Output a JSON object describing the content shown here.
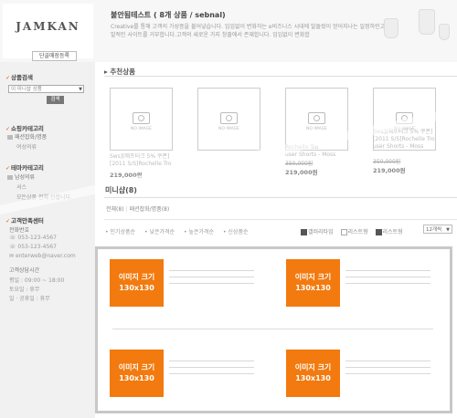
{
  "header": {
    "logo": "JAMKAN",
    "signup_label": "단골매장등록",
    "shop_title": "불안됨테스트 ( 8개 상품 / sebnal)",
    "desc_line1": "Creative를 통해 고객의 가성증을 불어넣습니다. 임임없이 변화하는 e비즈니스 시대에 발돌랐이 얻어지나는 일정하인고 윔",
    "desc_line2": "발적인 사이트를 거부합니다.고객의 새로운 가지 창출에서 존재합니다. 임임없이 변화합"
  },
  "sidebar": {
    "search": {
      "heading": "상품검색",
      "select_value": "이 미니샵 상품",
      "button": "검색"
    },
    "shop_category": {
      "heading": "쇼핑카테고리",
      "item": "패션잡화/명품",
      "sub": "여성의류"
    },
    "theme_category": {
      "heading": "테마카테고리",
      "item": "남성의류",
      "sub1": "셔스",
      "sub2": "모든상품 전체 진합니다."
    },
    "customer": {
      "heading": "고객만족센터",
      "phone_label": "전화번호",
      "phone1": "053-123-4567",
      "phone2": "053-123-4567",
      "email": "enterweb@naver.com",
      "hours_label": "고객상담시간",
      "weekday": "평일 : 09:00 ~ 18:00",
      "saturday": "토요일 : 휴무",
      "sunday": "일 · 공휴일 : 휴무"
    }
  },
  "recommended": {
    "heading": "추천상품",
    "no_image": "NO IMAGE",
    "items": [
      {
        "name1": "Sws](애프터크 5% 쿠폰]",
        "name2": "[2011 S/S]Rochelle Tro",
        "old": "",
        "price": "219,000원"
      },
      {
        "name1": "",
        "name2": "",
        "old": "",
        "price": ""
      },
      {
        "name1": "",
        "name2": "Rochelle Tro",
        "name3": "user Shorts - Moss",
        "old": "350,000원",
        "price": "219,000원"
      },
      {
        "name1": "Sws](애프터크 5% 쿠폰]",
        "name2": "[2011 S/S]Rochelle Tro",
        "name3": "user Shorts - Moss",
        "old": "350,000원",
        "price": "219,000원"
      }
    ]
  },
  "minishop": {
    "title": "미니샵(8)",
    "breadcrumb_all": "전체(8)",
    "breadcrumb_cat": "패션잡화/명품(8)",
    "sort": [
      "인기상품순",
      "낮은가격순",
      "높은가격순",
      "신상품순"
    ],
    "view_options": [
      "갤러리타입",
      "리스트형",
      "리스트형"
    ],
    "perpage": "12개씩",
    "thumb_line1": "이미지 크기",
    "thumb_line2": "130x130"
  },
  "colors": {
    "accent": "#f27a0f",
    "check_mark": "#e24a1a"
  }
}
